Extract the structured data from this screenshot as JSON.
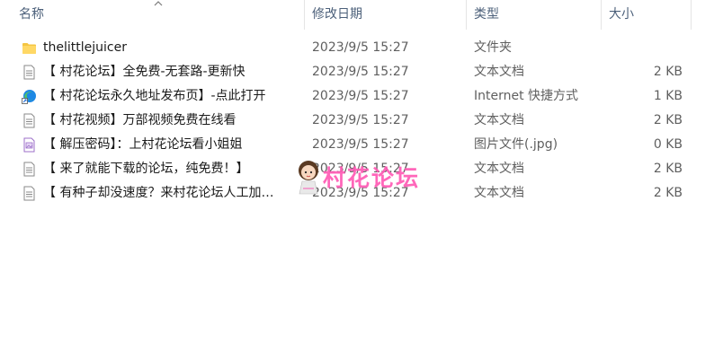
{
  "header": {
    "name": "名称",
    "date": "修改日期",
    "type": "类型",
    "size": "大小"
  },
  "rows": [
    {
      "name": "thelittlejuicer",
      "date": "",
      "type": "文件夹",
      "size": "",
      "icon": "folder-icon"
    },
    {
      "name": "【 村花论坛】全免费-无套路-更新快",
      "date": "2023/9/5 15:27",
      "type": "文本文档",
      "size": "2 KB",
      "icon": "text-file-icon"
    },
    {
      "name": "【 村花论坛永久地址发布页】-点此打开",
      "date": "2023/9/5 15:27",
      "type": "Internet 快捷方式",
      "size": "1 KB",
      "icon": "edge-shortcut-icon"
    },
    {
      "name": "【 村花视频】万部视频免费在线看",
      "date": "2023/9/5 15:27",
      "type": "文本文档",
      "size": "2 KB",
      "icon": "text-file-icon"
    },
    {
      "name": "【 解压密码】：上村花论坛看小姐姐",
      "date": "2023/9/5 15:27",
      "type": "图片文件(.jpg)",
      "size": "0 KB",
      "icon": "image-file-icon"
    },
    {
      "name": "【 来了就能下载的论坛，纯免费！】",
      "date": "2023/9/5 15:27",
      "type": "文本文档",
      "size": "2 KB",
      "icon": "text-file-icon"
    },
    {
      "name": "【 有种子却没速度？来村花论坛人工加…",
      "date": "2023/9/5 15:27",
      "type": "文本文档",
      "size": "2 KB",
      "icon": "text-file-icon"
    }
  ],
  "folder_date": "2023/9/5 15:27",
  "watermark": {
    "text": "村花论坛",
    "icon": "girl-avatar-icon"
  },
  "colors": {
    "header_text": "#4c607a",
    "folder": "#f4c542",
    "watermark": "#ff5bb5",
    "edge": "#1e88e5"
  }
}
